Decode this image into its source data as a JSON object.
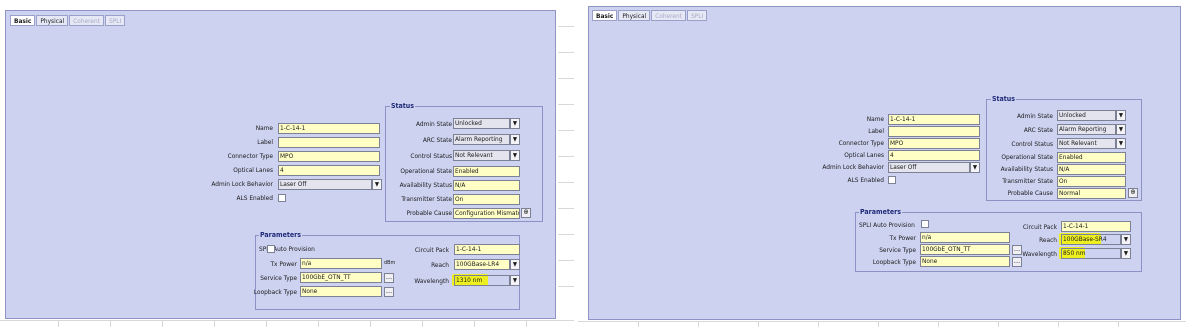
{
  "left": {
    "tabs": [
      {
        "label": "Basic",
        "state": "active"
      },
      {
        "label": "Physical",
        "state": "normal"
      },
      {
        "label": "Coherent",
        "state": "disabled"
      },
      {
        "label": "SPLI",
        "state": "disabled"
      }
    ],
    "basic": {
      "name_label": "Name",
      "name_value": "1-C-14-1",
      "label_label": "Label",
      "label_value": "",
      "connector_label": "Connector Type",
      "connector_value": "MPO",
      "lanes_label": "Optical Lanes",
      "lanes_value": "4",
      "lock_label": "Admin Lock Behavior",
      "lock_value": "Laser Off",
      "als_label": "ALS Enabled"
    },
    "status": {
      "title": "Status",
      "admin_label": "Admin State",
      "admin_value": "Unlocked",
      "arc_label": "ARC State",
      "arc_value": "Alarm Reporting",
      "control_label": "Control Status",
      "control_value": "Not Relevant",
      "oper_label": "Operational State",
      "oper_value": "Enabled",
      "avail_label": "Availability Status",
      "avail_value": "N/A",
      "tx_label": "Transmitter State",
      "tx_value": "On",
      "cause_label": "Probable Cause",
      "cause_value": "Configuration Mismatch"
    },
    "params": {
      "title": "Parameters",
      "spli_label": "SPLI Auto Provision",
      "txp_label": "Tx Power",
      "txp_value": "n/a",
      "txp_unit": "dBm",
      "service_label": "Service Type",
      "service_value": "100GbE_OTN_TT",
      "loop_label": "Loopback Type",
      "loop_value": "None",
      "pack_label": "Circuit Pack",
      "pack_value": "1-C-14-1",
      "reach_label": "Reach",
      "reach_value": "100GBase-LR4",
      "wave_label": "Wavelength",
      "wave_value": "1310 nm"
    }
  },
  "right": {
    "tabs": [
      {
        "label": "Basic",
        "state": "active"
      },
      {
        "label": "Physical",
        "state": "normal"
      },
      {
        "label": "Coherent",
        "state": "disabled"
      },
      {
        "label": "SPLI",
        "state": "disabled"
      }
    ],
    "basic": {
      "name_label": "Name",
      "name_value": "1-C-14-1",
      "label_label": "Label",
      "label_value": "",
      "connector_label": "Connector Type",
      "connector_value": "MPO",
      "lanes_label": "Optical Lanes",
      "lanes_value": "4",
      "lock_label": "Admin Lock Behavior",
      "lock_value": "Laser Off",
      "als_label": "ALS Enabled"
    },
    "status": {
      "title": "Status",
      "admin_label": "Admin State",
      "admin_value": "Unlocked",
      "arc_label": "ARC State",
      "arc_value": "Alarm Reporting",
      "control_label": "Control Status",
      "control_value": "Not Relevant",
      "oper_label": "Operational State",
      "oper_value": "Enabled",
      "avail_label": "Availability Status",
      "avail_value": "N/A",
      "tx_label": "Transmitter State",
      "tx_value": "On",
      "cause_label": "Probable Cause",
      "cause_value": "Normal"
    },
    "params": {
      "title": "Parameters",
      "spli_label": "SPLI Auto Provision",
      "txp_label": "Tx Power",
      "txp_value": "n/a",
      "service_label": "Service Type",
      "service_value": "100GbE_OTN_TT",
      "loop_label": "Loopback Type",
      "loop_value": "None",
      "pack_label": "Circuit Pack",
      "pack_value": "1-C-14-1",
      "reach_label": "Reach",
      "reach_value": "100GBase-SR4",
      "wave_label": "Wavelength",
      "wave_value": "850 nm"
    }
  },
  "colors": {
    "panel_bg": "#cdd2f0",
    "field_bg": "#fffec4",
    "highlight": "#f2f20a",
    "group_title": "#1f2a78"
  },
  "icons": {
    "dropdown": "chevron-down-icon",
    "more": "ellipsis-icon",
    "cause_detail": "target-icon"
  }
}
